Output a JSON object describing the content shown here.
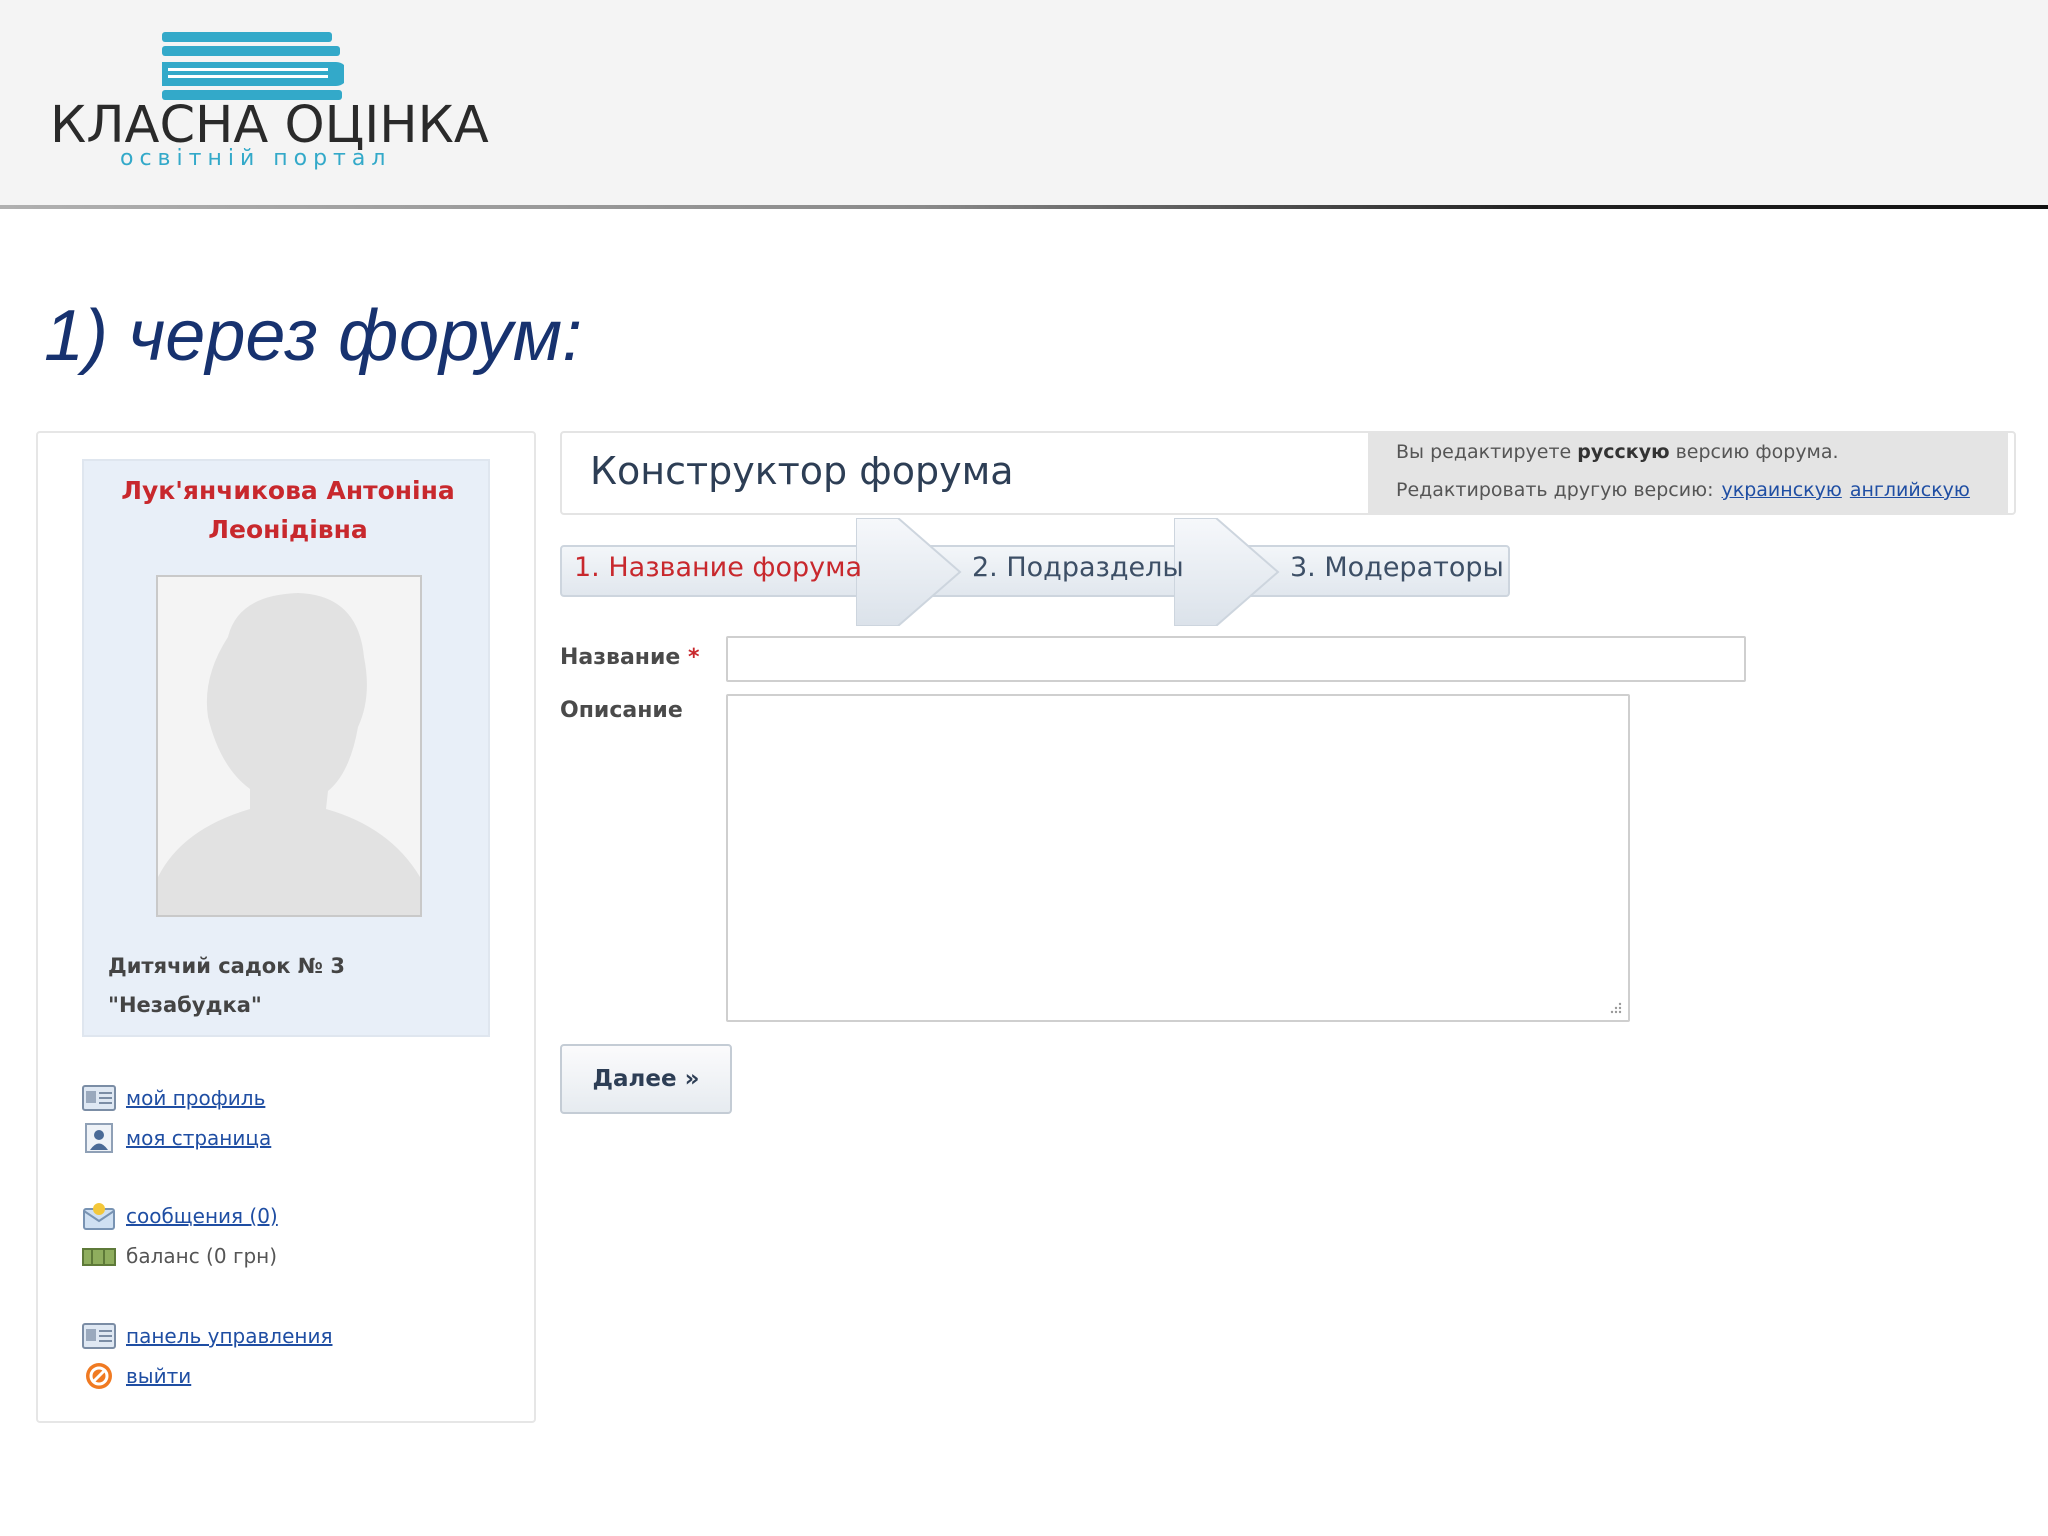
{
  "brand": {
    "name": "КЛАСНА ОЦІНКА",
    "tagline": "освітній портал"
  },
  "slide": {
    "heading": "1) через форум:"
  },
  "profile": {
    "name_line1": "Лук'янчикова Антоніна",
    "name_line2": "Леонідівна",
    "org_line1": "Дитячий садок № 3",
    "org_line2": "\"Незабудка\""
  },
  "menu": {
    "my_profile": "мой профиль",
    "my_page": "моя страница",
    "messages": "сообщения (0)",
    "balance": "баланс (0 грн)",
    "control_panel": "панель управления",
    "logout": "выйти"
  },
  "constructor": {
    "title": "Конструктор форума",
    "version_prefix": "Вы редактируете",
    "version_bold": "русскую",
    "version_suffix": "версию форума.",
    "edit_other_label": "Редактировать другую версию:",
    "lang_ukrainian": "украинскую",
    "lang_english": "английскую"
  },
  "steps": [
    {
      "label": "1. Название форума",
      "active": true
    },
    {
      "label": "2. Подразделы",
      "active": false
    },
    {
      "label": "3. Модераторы",
      "active": false
    }
  ],
  "form": {
    "name_label": "Название",
    "required_mark": "*",
    "name_value": "",
    "description_label": "Описание",
    "description_value": "",
    "next_button": "Далее »"
  },
  "colors": {
    "accent_red": "#c8282d",
    "link_blue": "#1f4ea3",
    "brand_teal": "#33a9c9",
    "heading_navy": "#17326f"
  }
}
